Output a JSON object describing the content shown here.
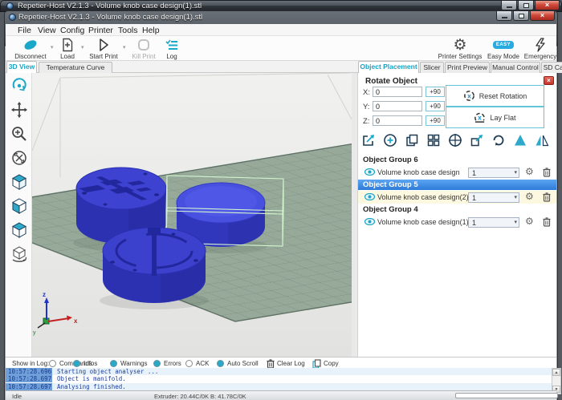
{
  "colors": {
    "accent_teal": "#1ba7c7",
    "selection_blue": "#2f7fd6",
    "object_blue": "#3a40cc",
    "bed_green": "#97aa99",
    "highlight_row": "#fdf9e0",
    "easy_badge_blue": "#29abe2",
    "close_red": "#c6352a"
  },
  "window": {
    "back_title": "Repetier-Host V2.1.3 - Volume knob case design(1).stl",
    "title": "Repetier-Host V2.1.3 - Volume knob case design(1).stl",
    "close_glyph": "×"
  },
  "icons": {
    "dropdown": "▾",
    "gear": "⚙",
    "scroll_up": "▲",
    "scroll_down": "▼"
  },
  "menu": {
    "items": [
      "File",
      "View",
      "Config",
      "Printer",
      "Tools",
      "Help"
    ]
  },
  "toolbar": {
    "disconnect": "Disconnect",
    "load": "Load",
    "start_print": "Start Print",
    "kill_print": "Kill Print",
    "log": "Log",
    "printer_settings": "Printer Settings",
    "easy_mode": "Easy Mode",
    "easy_badge": "EASY",
    "emergency_stop": "Emergency Stop"
  },
  "view_tabs": {
    "tab_3d": "3D View",
    "tab_temp": "Temperature Curve"
  },
  "right_tabs": {
    "placement": "Object Placement",
    "slicer": "Slicer",
    "preview": "Print Preview",
    "manual": "Manual Control",
    "sd": "SD Card"
  },
  "rotate": {
    "title": "Rotate Object",
    "axes": [
      {
        "label": "X:",
        "value": "0",
        "inc": "+90"
      },
      {
        "label": "Y:",
        "value": "0",
        "inc": "+90"
      },
      {
        "label": "Z:",
        "value": "0",
        "inc": "+90"
      }
    ],
    "reset": "Reset Rotation",
    "lay_flat": "Lay Flat"
  },
  "groups": [
    {
      "name": "Object Group 6",
      "item": "Volume knob case design",
      "count": "1",
      "selected": false
    },
    {
      "name": "Object Group 5",
      "item": "Volume knob case design(2)",
      "count": "1",
      "selected": true
    },
    {
      "name": "Object Group 4",
      "item": "Volume knob case design(1)",
      "count": "1",
      "selected": false
    }
  ],
  "log": {
    "label": "Show in Log:",
    "filters": [
      {
        "label": "Commands",
        "on": false
      },
      {
        "label": "Infos",
        "on": true
      },
      {
        "label": "Warnings",
        "on": true
      },
      {
        "label": "Errors",
        "on": true
      },
      {
        "label": "ACK",
        "on": false
      },
      {
        "label": "Auto Scroll",
        "on": true
      }
    ],
    "clear": "Clear Log",
    "copy": "Copy",
    "entries": [
      {
        "time": "10:57:28.696",
        "message": "Starting object analyser ..."
      },
      {
        "time": "10:57:28.697",
        "message": "Object is manifold."
      },
      {
        "time": "10:57:28.697",
        "message": "Analysing finished."
      }
    ]
  },
  "status": {
    "left": "Idle",
    "center": "Extruder: 20.44C/0K  B: 41.78C/0K"
  },
  "viewport": {
    "axis_x": "x",
    "axis_y": "y",
    "axis_z": "z"
  }
}
